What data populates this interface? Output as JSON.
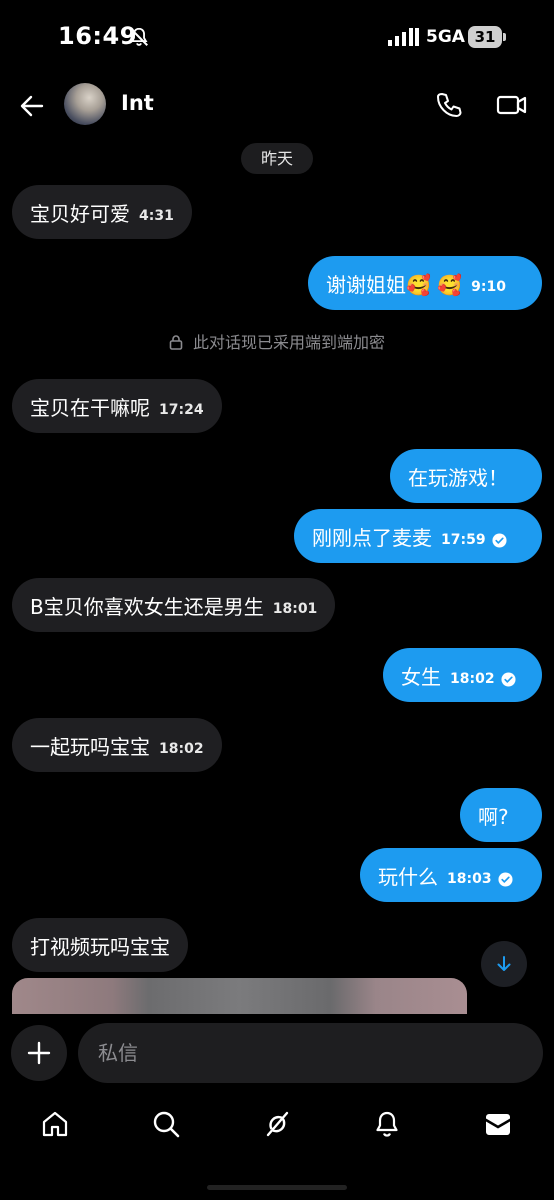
{
  "status_bar": {
    "time": "16:49",
    "network": "5GA",
    "battery": "31"
  },
  "header": {
    "contact_name": "Int"
  },
  "conversation": {
    "date_divider": "昨天",
    "encryption_note": "此对话现已采用端到端加密",
    "messages": [
      {
        "direction": "in",
        "text": "宝贝好可爱",
        "time": "4:31"
      },
      {
        "direction": "out",
        "text": "谢谢姐姐🥰 🥰",
        "time": "9:10"
      },
      {
        "direction": "in",
        "text": "宝贝在干嘛呢",
        "time": "17:24"
      },
      {
        "direction": "out",
        "text": "在玩游戏！",
        "time": ""
      },
      {
        "direction": "out",
        "text": "刚刚点了麦麦",
        "time": "17:59"
      },
      {
        "direction": "in",
        "text": "B宝贝你喜欢女生还是男生",
        "time": "18:01"
      },
      {
        "direction": "out",
        "text": "女生",
        "time": "18:02"
      },
      {
        "direction": "in",
        "text": "一起玩吗宝宝",
        "time": "18:02"
      },
      {
        "direction": "out",
        "text": "啊?",
        "time": ""
      },
      {
        "direction": "out",
        "text": "玩什么",
        "time": "18:03"
      },
      {
        "direction": "in",
        "text": "打视频玩吗宝宝",
        "time": ""
      }
    ]
  },
  "composer": {
    "placeholder": "私信"
  },
  "nav": {
    "items": [
      "home-icon",
      "search-icon",
      "grok-icon",
      "notifications-icon",
      "messages-icon"
    ]
  },
  "colors": {
    "outgoing_bubble": "#1d9bf0",
    "incoming_bubble": "#1f1f22",
    "background": "#000000"
  }
}
